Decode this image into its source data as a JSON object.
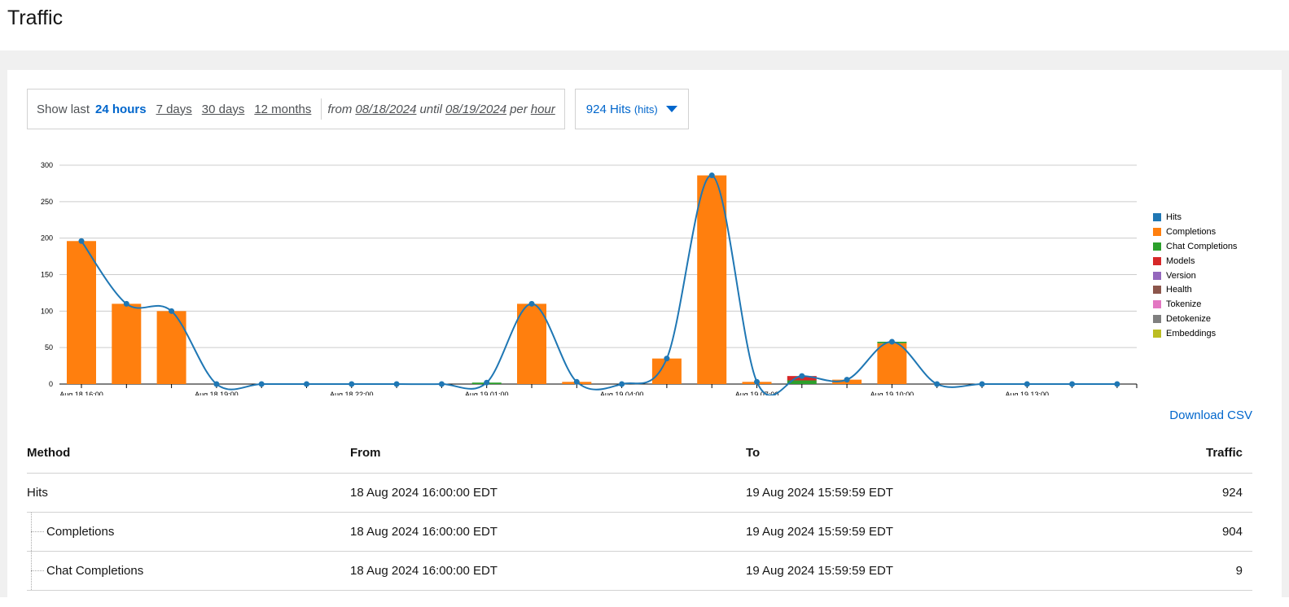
{
  "page": {
    "title": "Traffic"
  },
  "filters": {
    "show_last_label": "Show last",
    "periods": [
      "24 hours",
      "7 days",
      "30 days",
      "12 months"
    ],
    "active_period": "24 hours",
    "from_label": "from",
    "from_date": "08/18/2024",
    "until_label": "until",
    "until_date": "08/19/2024",
    "per_label": "per",
    "granularity": "hour",
    "metric": {
      "value_label": "924 Hits",
      "unit": "(hits)"
    }
  },
  "chart_data": {
    "type": "bar",
    "x": [
      "Aug 18 16:00",
      "Aug 18 17:00",
      "Aug 18 18:00",
      "Aug 18 19:00",
      "Aug 18 20:00",
      "Aug 18 21:00",
      "Aug 18 22:00",
      "Aug 18 23:00",
      "Aug 19 00:00",
      "Aug 19 01:00",
      "Aug 19 02:00",
      "Aug 19 03:00",
      "Aug 19 04:00",
      "Aug 19 05:00",
      "Aug 19 06:00",
      "Aug 19 07:00",
      "Aug 19 08:00",
      "Aug 19 09:00",
      "Aug 19 10:00",
      "Aug 19 11:00",
      "Aug 19 12:00",
      "Aug 19 13:00",
      "Aug 19 14:00",
      "Aug 19 15:00"
    ],
    "xtick_labels": [
      "Aug 18 16:00",
      "Aug 18 19:00",
      "Aug 18 22:00",
      "Aug 19 01:00",
      "Aug 19 04:00",
      "Aug 19 07:00",
      "Aug 19 10:00",
      "Aug 19 13:00"
    ],
    "ylim": [
      0,
      300
    ],
    "yticks": [
      0,
      50,
      100,
      150,
      200,
      250,
      300
    ],
    "grid": true,
    "legend": "right",
    "series": [
      {
        "name": "Hits",
        "type": "line",
        "color": "#1f77b4",
        "values": [
          196,
          110,
          100,
          0,
          0,
          0,
          0,
          0,
          0,
          2,
          110,
          3,
          0,
          35,
          286,
          3,
          11,
          6,
          58,
          0,
          0,
          0,
          0,
          0
        ]
      },
      {
        "name": "Completions",
        "type": "bar",
        "color": "#ff7f0e",
        "values": [
          196,
          110,
          100,
          0,
          0,
          0,
          0,
          0,
          0,
          0,
          110,
          3,
          0,
          35,
          286,
          3,
          0,
          6,
          56,
          0,
          0,
          0,
          0,
          0
        ]
      },
      {
        "name": "Chat Completions",
        "type": "bar",
        "color": "#2ca02c",
        "values": [
          0,
          0,
          0,
          0,
          0,
          0,
          0,
          0,
          0,
          2,
          0,
          0,
          0,
          0,
          0,
          0,
          5,
          0,
          2,
          0,
          0,
          0,
          0,
          0
        ]
      },
      {
        "name": "Models",
        "type": "bar",
        "color": "#d62728",
        "values": [
          0,
          0,
          0,
          0,
          0,
          0,
          0,
          0,
          0,
          0,
          0,
          0,
          0,
          0,
          0,
          0,
          6,
          0,
          0,
          0,
          0,
          0,
          0,
          0
        ]
      },
      {
        "name": "Version",
        "type": "bar",
        "color": "#9467bd",
        "values": [
          0,
          0,
          0,
          0,
          0,
          0,
          0,
          0,
          0,
          0,
          0,
          0,
          0,
          0,
          0,
          0,
          0,
          0,
          0,
          0,
          0,
          0,
          0,
          0
        ]
      },
      {
        "name": "Health",
        "type": "bar",
        "color": "#8c564b",
        "values": [
          0,
          0,
          0,
          0,
          0,
          0,
          0,
          0,
          0,
          0,
          0,
          0,
          0,
          0,
          0,
          0,
          0,
          0,
          0,
          0,
          0,
          0,
          0,
          0
        ]
      },
      {
        "name": "Tokenize",
        "type": "bar",
        "color": "#e377c2",
        "values": [
          0,
          0,
          0,
          0,
          0,
          0,
          0,
          0,
          0,
          0,
          0,
          0,
          0,
          0,
          0,
          0,
          0,
          0,
          0,
          0,
          0,
          0,
          0,
          0
        ]
      },
      {
        "name": "Detokenize",
        "type": "bar",
        "color": "#7f7f7f",
        "values": [
          0,
          0,
          0,
          0,
          0,
          0,
          0,
          0,
          0,
          0,
          0,
          0,
          0,
          0,
          0,
          0,
          0,
          0,
          0,
          0,
          0,
          0,
          0,
          0
        ]
      },
      {
        "name": "Embeddings",
        "type": "bar",
        "color": "#bcbd22",
        "values": [
          0,
          0,
          0,
          0,
          0,
          0,
          0,
          0,
          0,
          0,
          0,
          0,
          0,
          0,
          0,
          0,
          0,
          0,
          0,
          0,
          0,
          0,
          0,
          0
        ]
      }
    ]
  },
  "download_label": "Download CSV",
  "table": {
    "headers": [
      "Method",
      "From",
      "To",
      "Traffic"
    ],
    "rows": [
      {
        "method": "Hits",
        "from": "18 Aug 2024 16:00:00 EDT",
        "to": "19 Aug 2024 15:59:59 EDT",
        "traffic": "924",
        "child": false
      },
      {
        "method": "Completions",
        "from": "18 Aug 2024 16:00:00 EDT",
        "to": "19 Aug 2024 15:59:59 EDT",
        "traffic": "904",
        "child": true
      },
      {
        "method": "Chat Completions",
        "from": "18 Aug 2024 16:00:00 EDT",
        "to": "19 Aug 2024 15:59:59 EDT",
        "traffic": "9",
        "child": true
      }
    ]
  }
}
